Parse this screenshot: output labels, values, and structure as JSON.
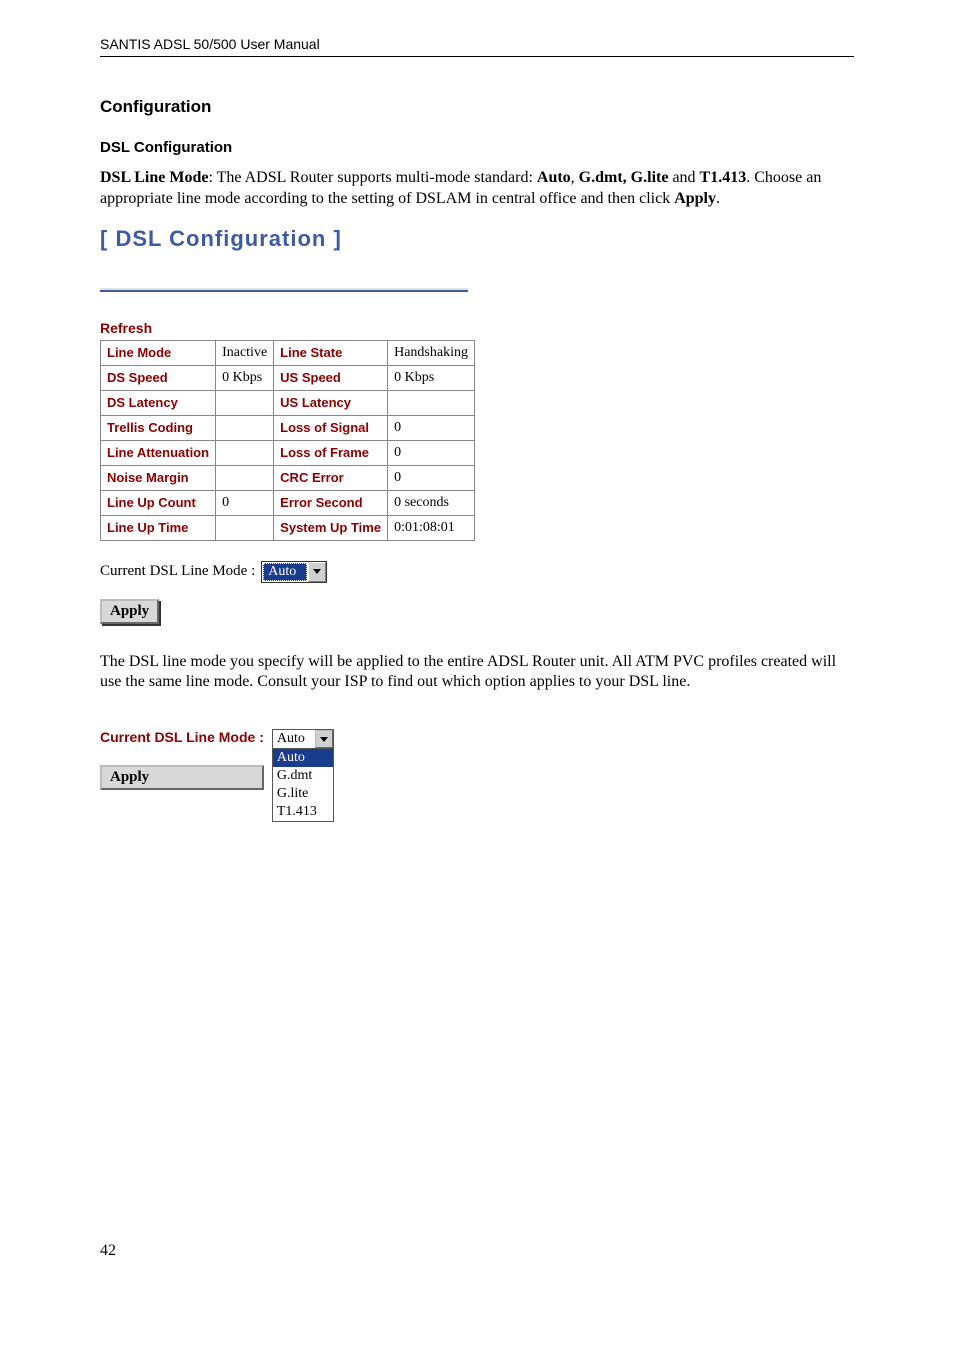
{
  "doc_header": "SANTIS ADSL 50/500 User Manual",
  "section_title": "Configuration",
  "subsection_title": "DSL Configuration",
  "intro": {
    "label_bold": "DSL Line Mode",
    "text_1": ": The ADSL Router supports multi-mode standard: ",
    "auto": "Auto",
    "comma1": ", ",
    "gdmt_glite": "G.dmt, G.lite",
    "and": " and ",
    "t1413": "T1.413",
    "text_2": ". Choose an appropriate line mode according to the setting of DSLAM in central office and then click ",
    "apply": "Apply",
    "text_3": "."
  },
  "panel_title": "[ DSL Configuration ]",
  "refresh": "Refresh",
  "table_rows": [
    {
      "l1": "Line Mode",
      "v1": "Inactive",
      "l2": "Line State",
      "v2": "Handshaking"
    },
    {
      "l1": "DS Speed",
      "v1": "0 Kbps",
      "l2": "US Speed",
      "v2": "0 Kbps"
    },
    {
      "l1": "DS Latency",
      "v1": "",
      "l2": "US Latency",
      "v2": ""
    },
    {
      "l1": "Trellis Coding",
      "v1": "",
      "l2": "Loss of Signal",
      "v2": "0"
    },
    {
      "l1": "Line Attenuation",
      "v1": "",
      "l2": "Loss of Frame",
      "v2": "0"
    },
    {
      "l1": "Noise Margin",
      "v1": "",
      "l2": "CRC Error",
      "v2": "0"
    },
    {
      "l1": "Line Up Count",
      "v1": "0",
      "l2": "Error Second",
      "v2": "0 seconds"
    },
    {
      "l1": "Line Up Time",
      "v1": "",
      "l2": "System Up Time",
      "v2": "0:01:08:01"
    }
  ],
  "mode_label": "Current DSL Line Mode :",
  "mode_selected": "Auto",
  "apply_label": "Apply",
  "note_text": "The DSL line mode you specify will be applied to the entire ADSL Router unit. All ATM PVC profiles created will use the same line mode. Consult your ISP to find out which option applies to your DSL line.",
  "dd2": {
    "label": "Current DSL Line Mode :",
    "head": "Auto",
    "options": [
      "Auto",
      "G.dmt",
      "G.lite",
      "T1.413"
    ],
    "selected_index": 0
  },
  "page_number": "42"
}
